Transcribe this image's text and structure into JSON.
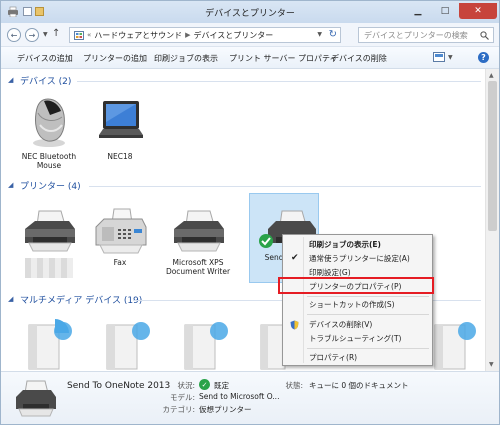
{
  "window": {
    "title": "デバイスとプリンター"
  },
  "address": {
    "crumbs": [
      "ハードウェアとサウンド",
      "デバイスとプリンター"
    ],
    "search_placeholder": "デバイスとプリンターの検索"
  },
  "commands": {
    "add_device": "デバイスの追加",
    "add_printer": "プリンターの追加",
    "print_jobs": "印刷ジョブの表示",
    "print_server_props": "プリント サーバー プロパティ",
    "remove_device": "デバイスの削除"
  },
  "groups": {
    "devices": {
      "label": "デバイス (2)",
      "items": [
        {
          "label": "NEC Bluetooth Mouse",
          "icon": "mouse-icon"
        },
        {
          "label": "NEC18",
          "icon": "laptop-icon"
        }
      ]
    },
    "printers": {
      "label": "プリンター (4)",
      "items": [
        {
          "label": "",
          "icon": "printer-icon"
        },
        {
          "label": "Fax",
          "icon": "fax-icon"
        },
        {
          "label": "Microsoft XPS Document Writer",
          "icon": "printer-icon"
        },
        {
          "label": "Send To OneNote 2013",
          "label_partial": "Send OneNo",
          "icon": "printer-default-icon"
        }
      ]
    },
    "multimedia": {
      "label": "マルチメディア デバイス (19)"
    }
  },
  "context_menu": {
    "items": [
      {
        "label": "印刷ジョブの表示(E)",
        "bold": true
      },
      {
        "label": "通常使うプリンターに設定(A)",
        "checked": true
      },
      {
        "label": "印刷設定(G)"
      },
      {
        "label": "プリンターのプロパティ(P)",
        "highlighted": true
      },
      {
        "label": "ショートカットの作成(S)"
      },
      {
        "label": "デバイスの削除(V)",
        "shield": true
      },
      {
        "label": "トラブルシューティング(T)"
      },
      {
        "label": "プロパティ(R)"
      }
    ]
  },
  "details": {
    "name": "Send To OneNote 2013",
    "status_key": "状況:",
    "status_value": "既定",
    "model_key": "モデル:",
    "model_value": "Send to Microsoft O...",
    "category_key": "カテゴリ:",
    "category_value": "仮想プリンター",
    "state_key": "状態:",
    "state_value": "キューに 0 個のドキュメント"
  },
  "colors": {
    "accent": "#1e4e9e",
    "highlight_border": "#e51c23",
    "selection": "#cce4f7",
    "close_button": "#c7443c",
    "status_ok": "#2aa34a"
  }
}
